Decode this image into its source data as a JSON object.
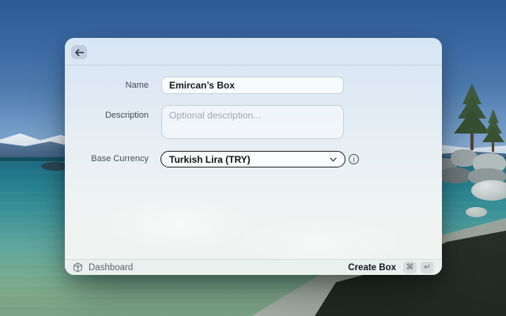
{
  "dialog": {
    "form": {
      "name": {
        "label": "Name",
        "value": "Emircan’s Box"
      },
      "description": {
        "label": "Description",
        "placeholder": "Optional description..."
      },
      "base_currency": {
        "label": "Base Currency",
        "value": "Turkish Lira (TRY)"
      }
    },
    "footer": {
      "dashboard_label": "Dashboard",
      "create_label": "Create Box",
      "shortcut_keys": [
        "⌘",
        "↵"
      ]
    }
  },
  "icons": {
    "info": "i"
  },
  "colors": {
    "select_focus_border": "#1d1f21",
    "window_tint_top": "#d8e5f4",
    "window_tint_bottom": "#edf1ef"
  }
}
